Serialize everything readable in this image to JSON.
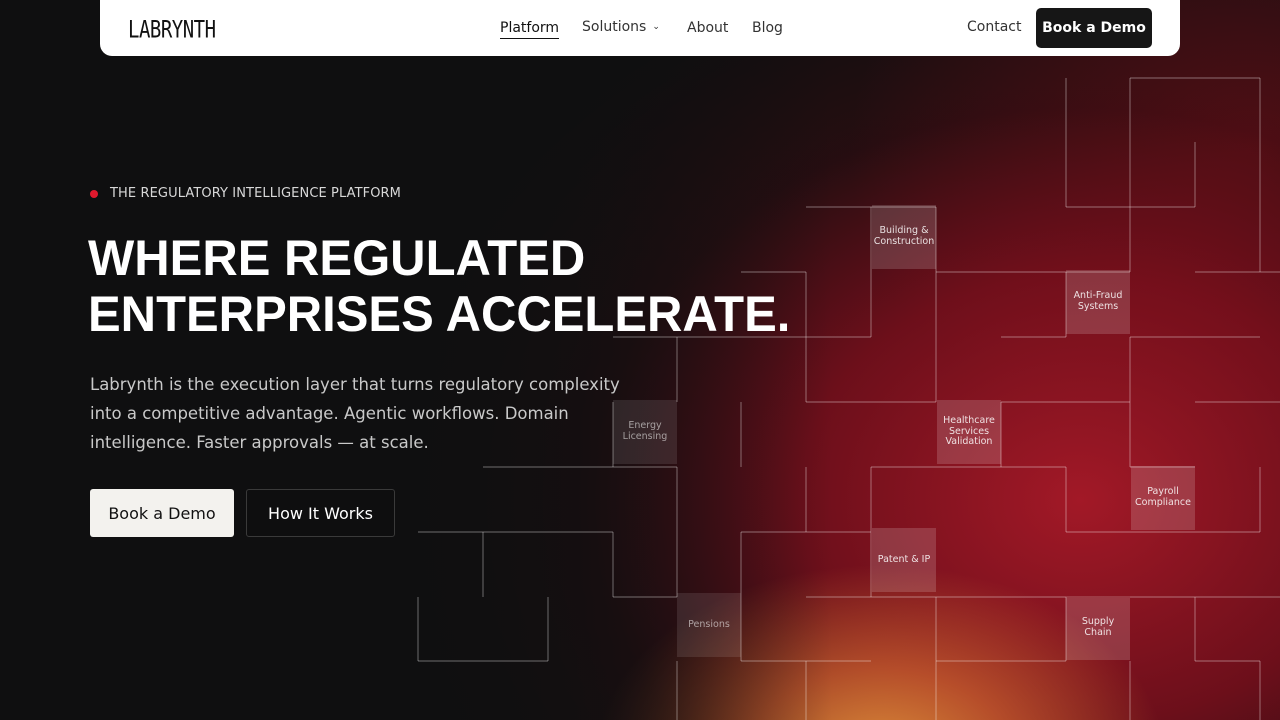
{
  "nav": {
    "logo": "LABRYNTH",
    "links": [
      {
        "label": "Platform",
        "active": true
      },
      {
        "label": "Solutions",
        "dropdown": true
      },
      {
        "label": "About"
      },
      {
        "label": "Blog"
      }
    ],
    "contact": "Contact",
    "cta": "Book a Demo"
  },
  "hero": {
    "eyebrow": "THE REGULATORY INTELLIGENCE PLATFORM",
    "headline": [
      "WHERE REGULATED",
      "ENTERPRISES ACCELERATE."
    ],
    "lede": [
      "Labrynth is the execution layer that turns regulatory complexity",
      "into a competitive advantage. Agentic workflows. Domain",
      "intelligence. Faster approvals — at scale."
    ],
    "primary_cta": "Book a Demo",
    "secondary_cta": "How It Works"
  },
  "tiles": {
    "building": "Building & Construction",
    "antifraud": "Anti-Fraud Systems",
    "energy": "Energy Licensing",
    "healthcare": "Healthcare Services Validation",
    "payroll": "Payroll Compliance",
    "patent": "Patent & IP",
    "pensions": "Pensions",
    "supply": "Supply Chain"
  },
  "colors": {
    "accent_dot": "#e0192d",
    "nav_bg": "#ffffff",
    "page_bg": "#0f0f10",
    "maze_glow": "#aa1928",
    "maze_hot": "#e8963c"
  }
}
